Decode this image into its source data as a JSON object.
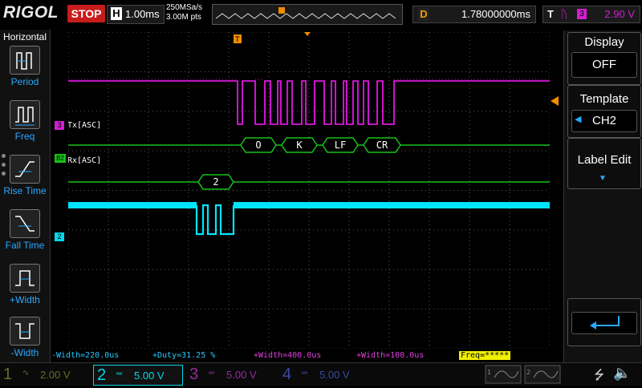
{
  "brand": "RIGOL",
  "run_state": "STOP",
  "timebase": {
    "label": "H",
    "value": "1.00ms"
  },
  "sampling": {
    "rate": "250MSa/s",
    "points": "3.00M pts"
  },
  "delay": {
    "label": "D",
    "value": "1.78000000ms"
  },
  "trigger": {
    "label": "T",
    "source": "3",
    "level": "2.90 V"
  },
  "left_menu": {
    "title": "Horizontal",
    "items": [
      "Period",
      "Freq",
      "Rise Time",
      "Fall Time",
      "+Width",
      "-Width"
    ]
  },
  "right_menu": {
    "display_label": "Display",
    "display_value": "OFF",
    "template_label": "Template",
    "template_value": "CH2",
    "label_edit": "Label Edit"
  },
  "channel_labels": {
    "tx": "Tx[ASC]",
    "rx": "Rx[ASC]",
    "ch3_marker": "3",
    "ch2_marker": "2",
    "bus_marker": "B2"
  },
  "decode": {
    "tx_bytes": [
      "O",
      "K",
      "LF",
      "CR"
    ],
    "rx_bytes": [
      "2"
    ]
  },
  "measurements": [
    {
      "text": "-Width=220.0us",
      "color": "#29c8ff"
    },
    {
      "text": "+Duty=31.25 %",
      "color": "#29c8ff"
    },
    {
      "text": "+Width=400.0us",
      "color": "#e040e0"
    },
    {
      "text": "+Width=100.0us",
      "color": "#e040e0"
    },
    {
      "text": "Freq=*****",
      "color": "#000000",
      "bg": "#f0f000"
    }
  ],
  "channels": [
    {
      "num": "1",
      "coupling": "∿",
      "scale": "2.00 V",
      "color": "#6a6a2a",
      "active": false
    },
    {
      "num": "2",
      "coupling": "═",
      "scale": "5.00 V",
      "color": "#00d8e8",
      "active": true
    },
    {
      "num": "3",
      "coupling": "═",
      "scale": "5.00 V",
      "color": "#9a2a9a",
      "active": false
    },
    {
      "num": "4",
      "coupling": "═",
      "scale": "5.00 V",
      "color": "#3a4aa0",
      "active": false
    }
  ],
  "colors": {
    "ch2": "#00e5ff",
    "ch3": "#ff1aff",
    "decode": "#18c018",
    "accent": "#f08c00"
  }
}
